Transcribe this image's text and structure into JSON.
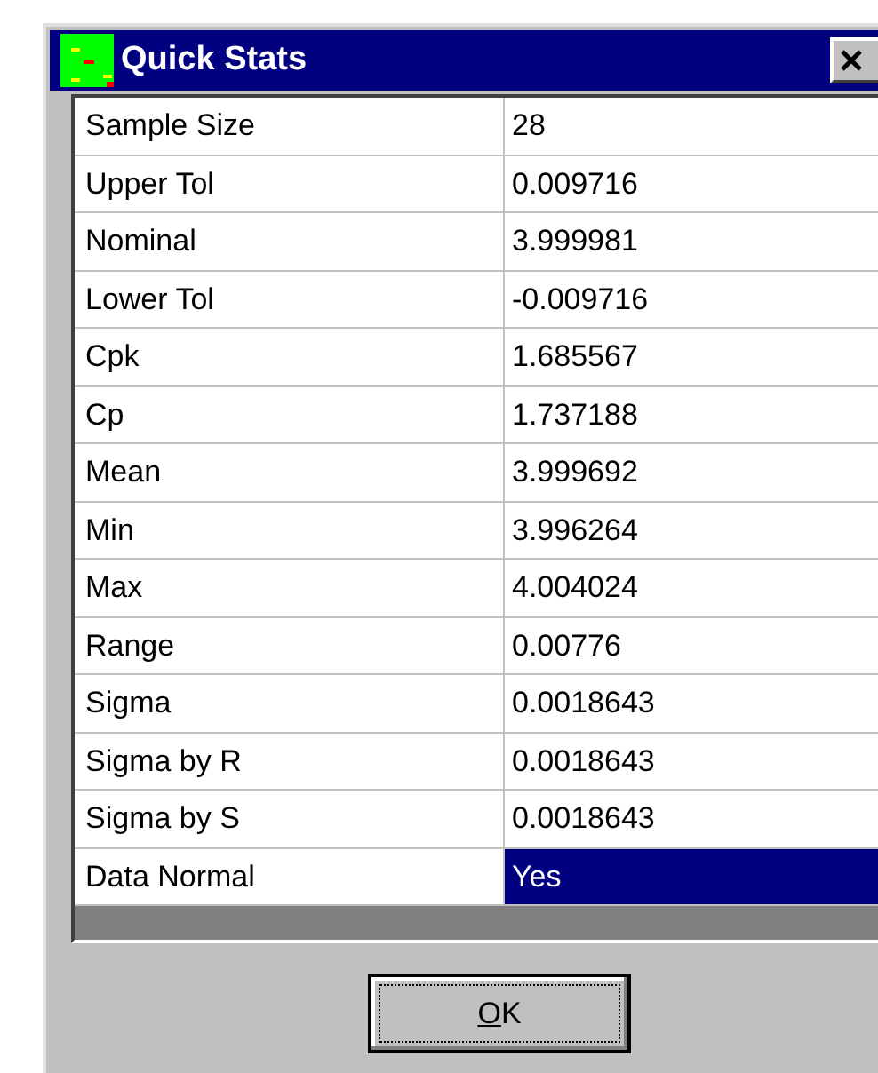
{
  "window": {
    "title": "Quick Stats"
  },
  "table": {
    "rows": [
      {
        "label": "Sample Size",
        "value": "28",
        "selected": false
      },
      {
        "label": "Upper Tol",
        "value": "0.009716",
        "selected": false
      },
      {
        "label": "Nominal",
        "value": "3.999981",
        "selected": false
      },
      {
        "label": "Lower Tol",
        "value": "-0.009716",
        "selected": false
      },
      {
        "label": "Cpk",
        "value": "1.685567",
        "selected": false
      },
      {
        "label": "Cp",
        "value": "1.737188",
        "selected": false
      },
      {
        "label": "Mean",
        "value": "3.999692",
        "selected": false
      },
      {
        "label": "Min",
        "value": "3.996264",
        "selected": false
      },
      {
        "label": "Max",
        "value": "4.004024",
        "selected": false
      },
      {
        "label": "Range",
        "value": "0.00776",
        "selected": false
      },
      {
        "label": "Sigma",
        "value": "0.0018643",
        "selected": false
      },
      {
        "label": "Sigma by R",
        "value": "0.0018643",
        "selected": false
      },
      {
        "label": "Sigma by S",
        "value": "0.0018643",
        "selected": false
      },
      {
        "label": "Data Normal",
        "value": "Yes",
        "selected": true
      }
    ]
  },
  "buttons": [
    {
      "label": "OK",
      "focused": true,
      "underline_first": true
    }
  ]
}
